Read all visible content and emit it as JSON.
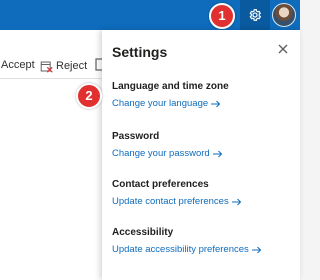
{
  "header": {
    "brand_color": "#0f6cbd",
    "gear_icon": "gear-icon",
    "avatar": "user-avatar"
  },
  "callouts": [
    "1",
    "2"
  ],
  "background_toolbar": {
    "accept_label": "Accept",
    "reject_label": "Reject"
  },
  "settings": {
    "title": "Settings",
    "close_icon": "close-icon",
    "sections": [
      {
        "title": "Language and time zone",
        "link": "Change your language"
      },
      {
        "title": "Password",
        "link": "Change your password"
      },
      {
        "title": "Contact preferences",
        "link": "Update contact preferences"
      },
      {
        "title": "Accessibility",
        "link": "Update accessibility preferences"
      }
    ]
  }
}
